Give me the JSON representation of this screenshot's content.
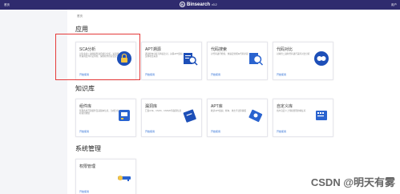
{
  "topbar": {
    "home_label": "首页",
    "brand_name": "Binsearch",
    "brand_version": "v3.2",
    "user_label": "用户"
  },
  "breadcrumb": "首页",
  "sections": {
    "apps": "应用",
    "knowledge": "知识库",
    "system": "系统管理"
  },
  "apps": [
    {
      "title": "SCA分析",
      "desc": "对企业的二进制组件进行成分分析，识别组件漏洞及许可证风险，保障软件供应链安全",
      "link": "开始使用"
    },
    {
      "title": "APT溯源",
      "desc": "通过样本分析与特征比对，关联APT组织，追溯攻击来源",
      "link": "开始使用"
    },
    {
      "title": "代码搜索",
      "desc": "对代码进行检索，快速定位相似代码片段",
      "link": "开始使用"
    },
    {
      "title": "代码对比",
      "desc": "对两份二进制代码进行差异对比分析",
      "link": "开始使用"
    }
  ],
  "knowledge": [
    {
      "title": "组件库",
      "desc": "管理各类开源组件及其版本信息，为成分分析提供依据",
      "link": "开始使用"
    },
    {
      "title": "漏洞库",
      "desc": "汇集CVE、CNVD、CNNVD等漏洞信息",
      "link": "开始使用"
    },
    {
      "title": "APT库",
      "desc": "收录APT组织、样本、攻击手法等情报",
      "link": "开始使用"
    },
    {
      "title": "自定义库",
      "desc": "用户自定义上传和管理的特征库",
      "link": "开始使用"
    }
  ],
  "system": [
    {
      "title": "权限管理",
      "desc": "",
      "link": "开始使用"
    }
  ],
  "watermark": "CSDN @明天有雾",
  "colors": {
    "topbar": "#2f2b6e",
    "accent": "#2f6fd6",
    "highlight": "#e53a3a"
  }
}
